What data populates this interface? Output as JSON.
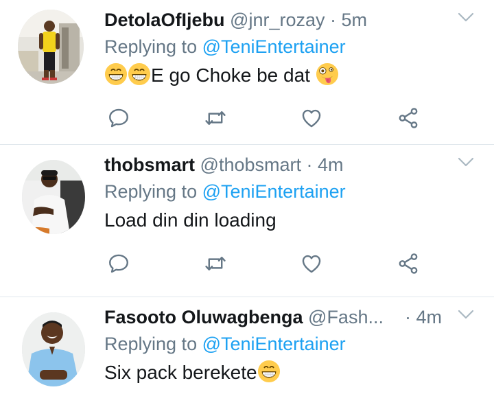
{
  "tweets": [
    {
      "name": "DetolaOfIjebu",
      "handle": "@jnr_rozay",
      "separator": "·",
      "time": "5m",
      "replying_prefix": "Replying to",
      "replying_to": "@TeniEntertainer",
      "text": "E go Choke be dat",
      "emojis": [
        "grinning-face-with-smiling-eyes",
        "grinning-face-with-smiling-eyes",
        "zany-face"
      ]
    },
    {
      "name": "thobsmart",
      "handle": "@thobsmart",
      "separator": "·",
      "time": "4m",
      "replying_prefix": "Replying to",
      "replying_to": "@TeniEntertainer",
      "text": "Load din din loading"
    },
    {
      "name": "Fasooto Oluwagbenga",
      "handle": "@Fash...",
      "separator": "·",
      "time": "4m",
      "replying_prefix": "Replying to",
      "replying_to": "@TeniEntertainer",
      "text": "Six pack berekete",
      "emojis": [
        "grinning-face-with-smiling-eyes"
      ]
    }
  ],
  "colors": {
    "icon_gray": "#657786",
    "link_blue": "#1da1f2",
    "divider": "#e1e8ed"
  },
  "icons": [
    "reply-icon",
    "retweet-icon",
    "like-icon",
    "share-icon",
    "chevron-down-icon"
  ]
}
